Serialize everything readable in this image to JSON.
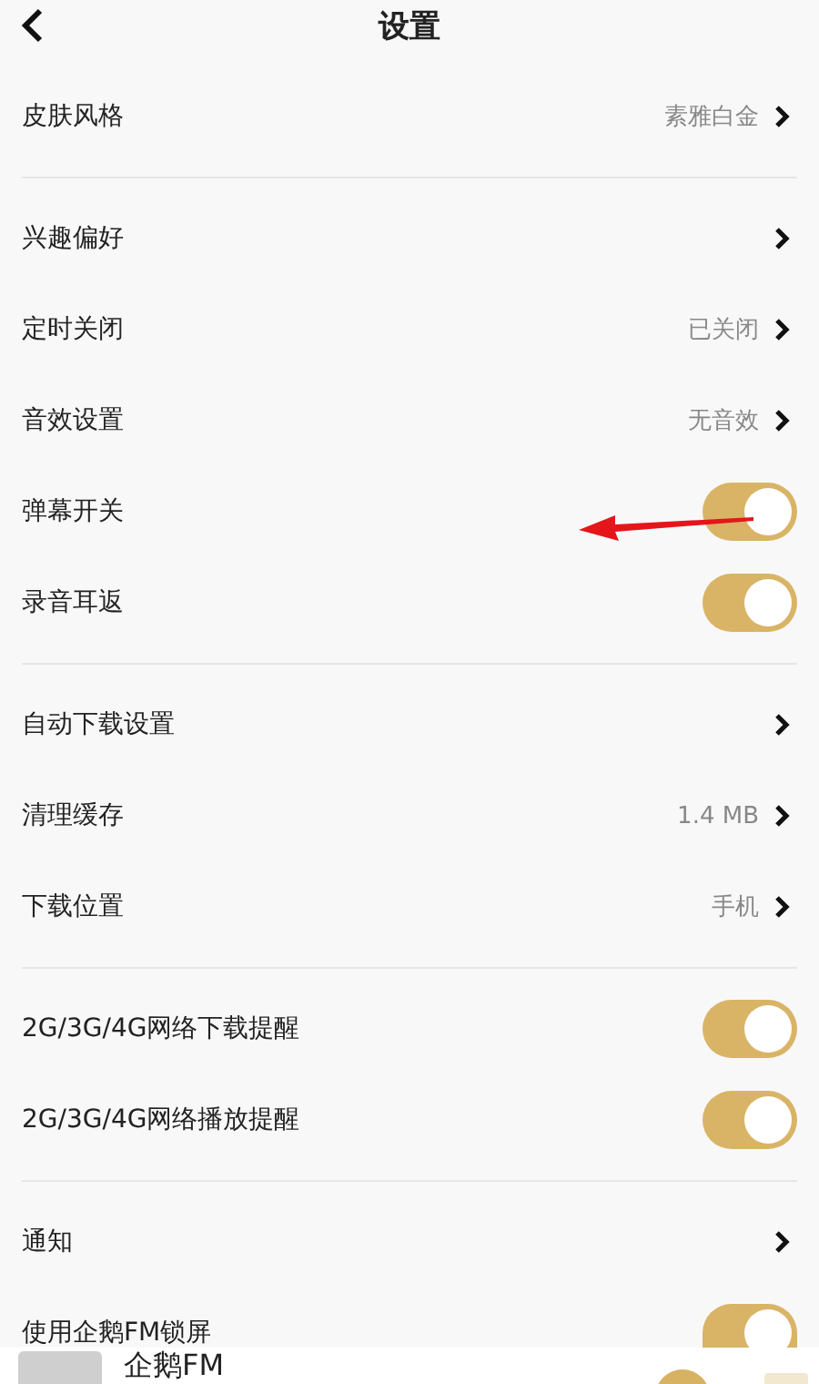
{
  "header": {
    "title": "设置"
  },
  "sections": [
    {
      "rows": [
        {
          "kind": "link",
          "label": "皮肤风格",
          "value": "素雅白金"
        }
      ]
    },
    {
      "rows": [
        {
          "kind": "link",
          "label": "兴趣偏好"
        },
        {
          "kind": "link",
          "label": "定时关闭",
          "value": "已关闭"
        },
        {
          "kind": "link",
          "label": "音效设置",
          "value": "无音效"
        },
        {
          "kind": "toggle",
          "label": "弹幕开关",
          "on": true
        },
        {
          "kind": "toggle",
          "label": "录音耳返",
          "on": true
        }
      ]
    },
    {
      "rows": [
        {
          "kind": "link",
          "label": "自动下载设置"
        },
        {
          "kind": "link",
          "label": "清理缓存",
          "value": "1.4 MB"
        },
        {
          "kind": "link",
          "label": "下载位置",
          "value": "手机"
        }
      ]
    },
    {
      "rows": [
        {
          "kind": "toggle",
          "label": "2G/3G/4G网络下载提醒",
          "on": true
        },
        {
          "kind": "toggle",
          "label": "2G/3G/4G网络播放提醒",
          "on": true
        }
      ]
    },
    {
      "rows": [
        {
          "kind": "link",
          "label": "通知"
        },
        {
          "kind": "toggle",
          "label": "使用企鹅FM锁屏",
          "on": true
        }
      ]
    }
  ],
  "mini_player": {
    "title": "企鹅FM"
  }
}
